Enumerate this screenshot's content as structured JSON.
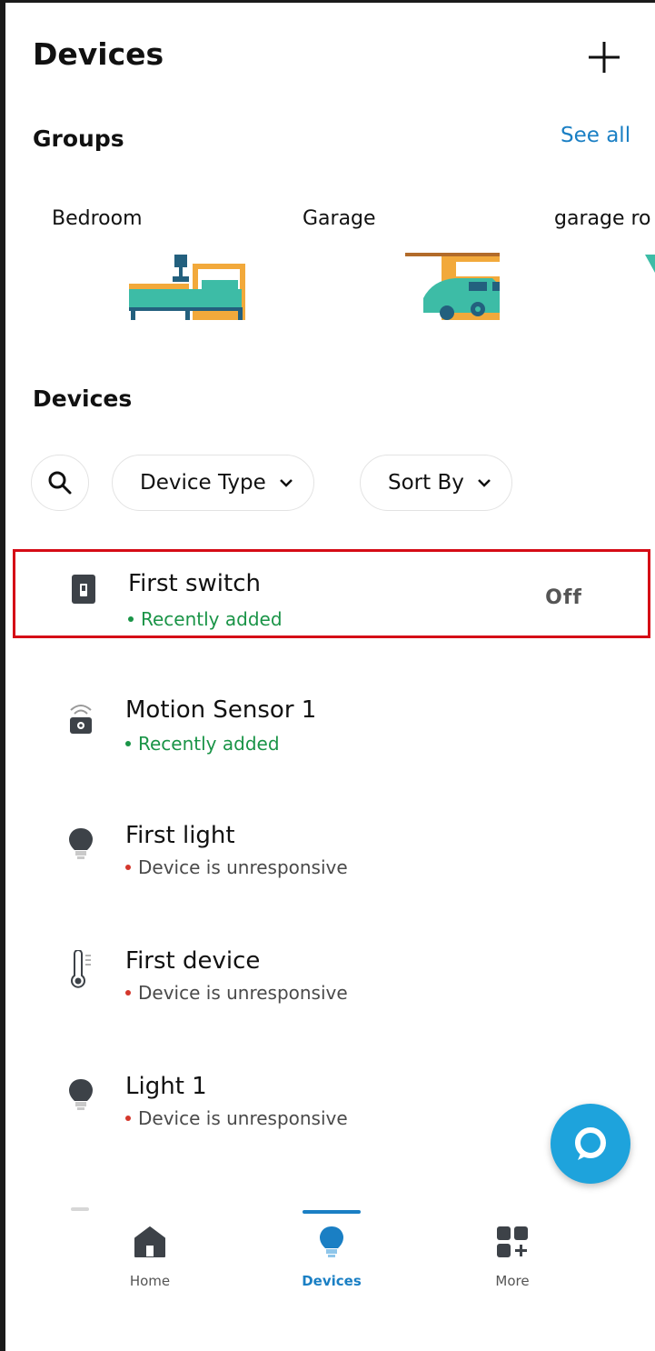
{
  "header": {
    "title": "Devices",
    "add_icon": "plus-icon"
  },
  "groups": {
    "title": "Groups",
    "see_all": "See all",
    "items": [
      {
        "label": "Bedroom",
        "icon": "bedroom-illustration"
      },
      {
        "label": "Garage",
        "icon": "garage-illustration"
      },
      {
        "label": "garage ro",
        "icon": "room-illustration"
      }
    ]
  },
  "devices": {
    "title": "Devices",
    "filters": {
      "search_icon": "search-icon",
      "device_type": "Device Type",
      "sort_by": "Sort By"
    },
    "items": [
      {
        "name": "First switch",
        "status": "Recently added",
        "status_color": "#1a9447",
        "state": "Off",
        "icon": "switch-icon"
      },
      {
        "name": "Motion Sensor 1",
        "status": "Recently added",
        "status_color": "#1a9447",
        "icon": "motion-sensor-icon"
      },
      {
        "name": "First light",
        "status": "Device is unresponsive",
        "status_color": "#d4372c",
        "icon": "bulb-icon"
      },
      {
        "name": "First device",
        "status": "Device is unresponsive",
        "status_color": "#d4372c",
        "icon": "thermometer-icon"
      },
      {
        "name": "Light 1",
        "status": "Device is unresponsive",
        "status_color": "#d4372c",
        "icon": "bulb-icon"
      }
    ]
  },
  "alexa_button": {
    "icon": "alexa-icon"
  },
  "bottom_nav": {
    "active": "Devices",
    "accent": "#1a7fc4",
    "items": [
      {
        "label": "Home",
        "icon": "home-icon"
      },
      {
        "label": "Devices",
        "icon": "bulb-icon"
      },
      {
        "label": "More",
        "icon": "more-grid-icon"
      }
    ]
  }
}
